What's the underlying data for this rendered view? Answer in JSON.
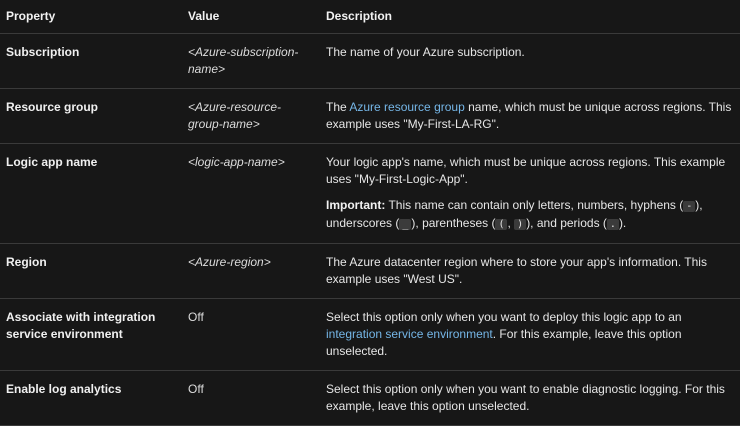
{
  "headers": {
    "property": "Property",
    "value": "Value",
    "description": "Description"
  },
  "rows": {
    "subscription": {
      "property": "Subscription",
      "value": "<Azure-subscription-name>",
      "description": "The name of your Azure subscription."
    },
    "resource_group": {
      "property": "Resource group",
      "value": "<Azure-resource-group-name>",
      "desc_pre": "The ",
      "desc_link": "Azure resource group",
      "desc_post": " name, which must be unique across regions. This example uses \"My-First-LA-RG\"."
    },
    "logic_app_name": {
      "property": "Logic app name",
      "value": "<logic-app-name>",
      "description": "Your logic app's name, which must be unique across regions. This example uses \"My-First-Logic-App\".",
      "important_label": "Important:",
      "important_text_1": " This name can contain only letters, numbers, hyphens (",
      "chip_hyphen": "-",
      "important_text_2": "), underscores (",
      "chip_underscore": "_",
      "important_text_3": "), parentheses (",
      "chip_paren_open": "(",
      "important_text_4": ", ",
      "chip_paren_close": ")",
      "important_text_5": "), and periods (",
      "chip_period": ".",
      "important_text_6": ")."
    },
    "region": {
      "property": "Region",
      "value": "<Azure-region>",
      "description": "The Azure datacenter region where to store your app's information. This example uses \"West US\"."
    },
    "ise": {
      "property": "Associate with integration service environment",
      "value": "Off",
      "desc_pre": "Select this option only when you want to deploy this logic app to an ",
      "desc_link": "integration service environment",
      "desc_post": ". For this example, leave this option unselected."
    },
    "log_analytics": {
      "property": "Enable log analytics",
      "value": "Off",
      "description": "Select this option only when you want to enable diagnostic logging. For this example, leave this option unselected."
    }
  },
  "colors": {
    "background": "#171717",
    "text": "#e6e6e6",
    "link": "#75b6e7",
    "border": "#3a3a3a",
    "chip": "#3b3b3b"
  }
}
